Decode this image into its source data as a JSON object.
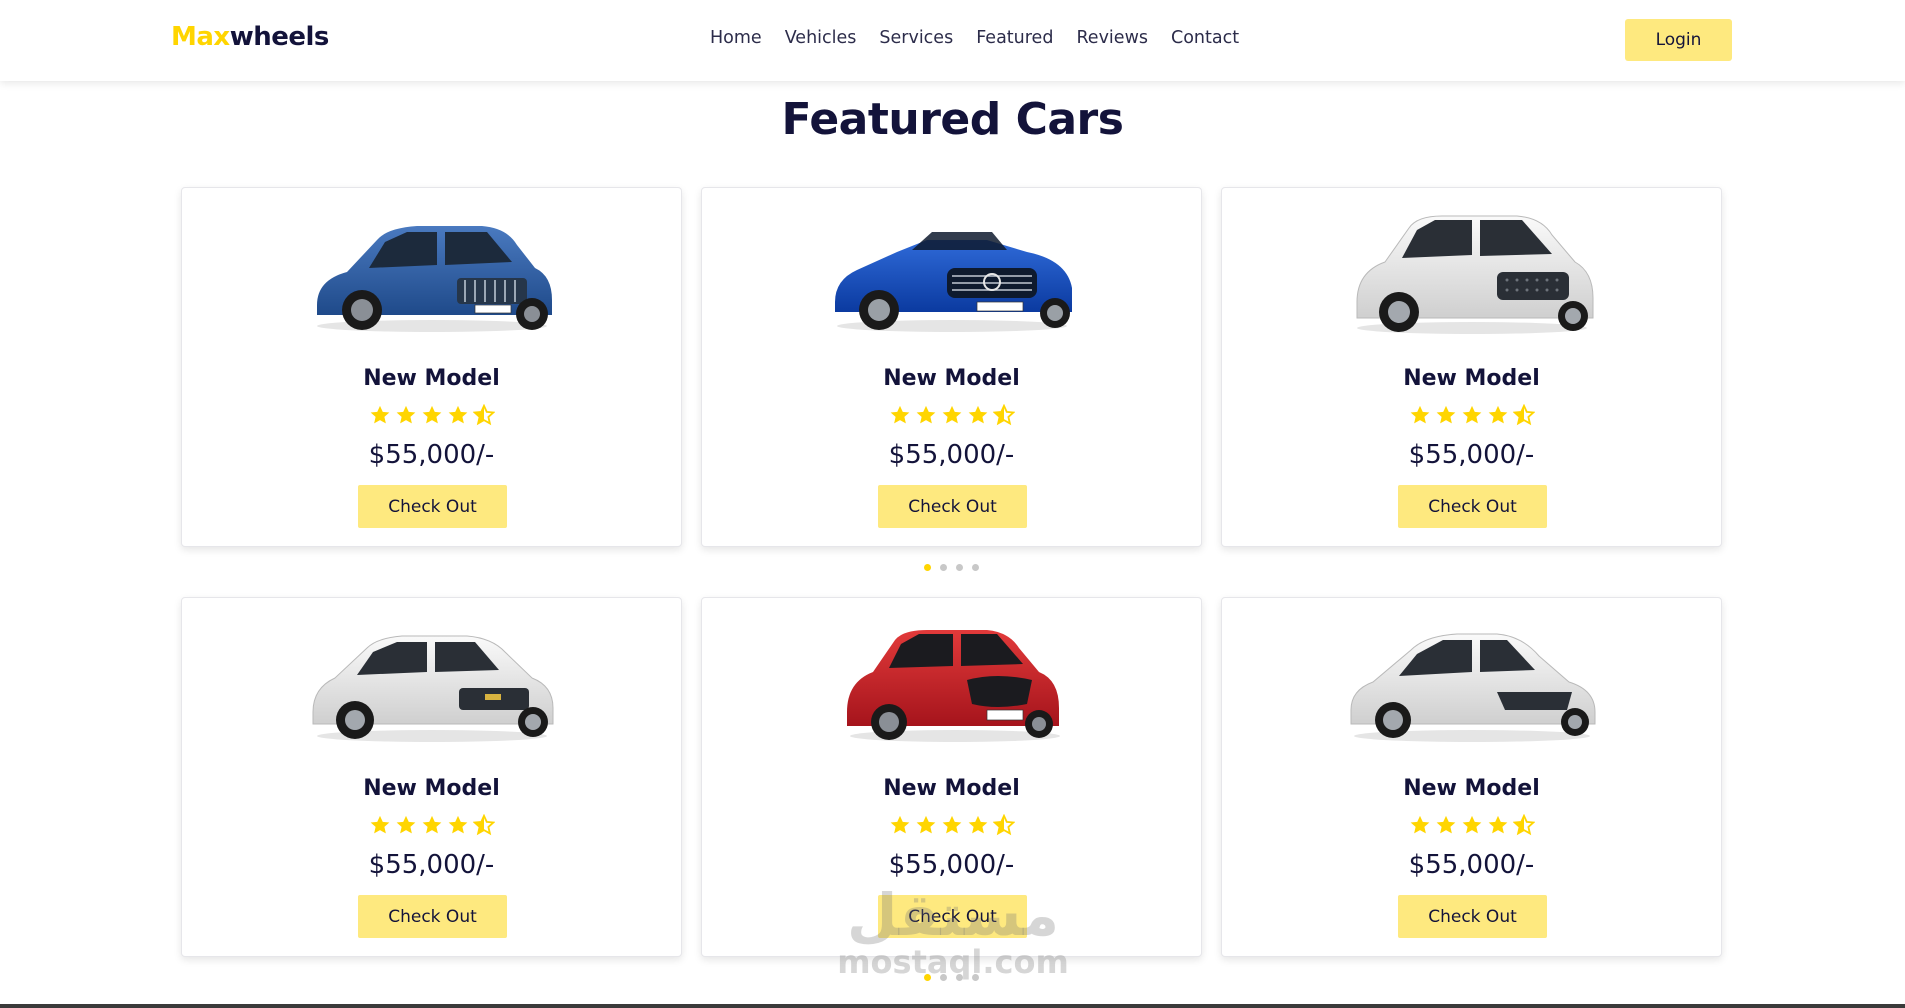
{
  "header": {
    "logo_accent": "Max",
    "logo_rest": "wheels",
    "nav": [
      "Home",
      "Vehicles",
      "Services",
      "Featured",
      "Reviews",
      "Contact"
    ],
    "login_label": "Login"
  },
  "section": {
    "title_part1": "Featured",
    "title_part2": "Cars"
  },
  "cards": [
    {
      "title": "New Model",
      "rating": 4.5,
      "price": "$55,000/-",
      "button": "Check Out",
      "car": "blue suv"
    },
    {
      "title": "New Model",
      "rating": 4.5,
      "price": "$55,000/-",
      "button": "Check Out",
      "car": "blue convertible"
    },
    {
      "title": "New Model",
      "rating": 4.5,
      "price": "$55,000/-",
      "button": "Check Out",
      "car": "white suv"
    },
    {
      "title": "New Model",
      "rating": 4.5,
      "price": "$55,000/-",
      "button": "Check Out",
      "car": "white crossover"
    },
    {
      "title": "New Model",
      "rating": 4.5,
      "price": "$55,000/-",
      "button": "Check Out",
      "car": "red suv"
    },
    {
      "title": "New Model",
      "rating": 4.5,
      "price": "$55,000/-",
      "button": "Check Out",
      "car": "white sedan"
    }
  ],
  "pagination": {
    "count": 4,
    "active": 1
  },
  "watermark": {
    "arabic": "مستقل",
    "latin": "mostaql.com"
  },
  "colors": {
    "accent": "#ffd500",
    "button": "#fee97f",
    "text": "#13133a"
  }
}
